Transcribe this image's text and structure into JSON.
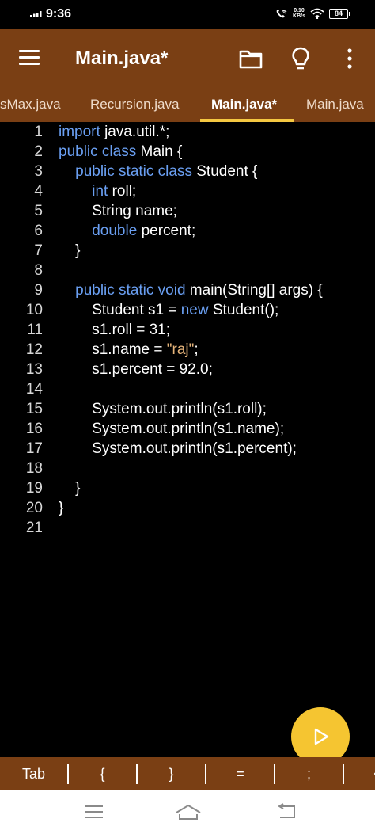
{
  "status": {
    "time": "9:36",
    "net_speed_value": "0.10",
    "net_speed_unit": "KB/s",
    "battery": "84"
  },
  "app_bar": {
    "title": "Main.java*",
    "icons": [
      "menu-icon",
      "folder-icon",
      "lightbulb-icon",
      "more-vert-icon"
    ]
  },
  "tabs": [
    {
      "label": "sMax.java"
    },
    {
      "label": "Recursion.java"
    },
    {
      "label": "Main.java*",
      "active": true
    },
    {
      "label": "Main.java"
    }
  ],
  "colors": {
    "app_bar": "#7a3f14",
    "keyword": "#6a9ff2",
    "string": "#e6b47a",
    "tab_indicator": "#f5c842",
    "fab": "#f5c531"
  },
  "editor": {
    "lines": [
      {
        "n": "1",
        "parts": [
          {
            "t": "import",
            "c": "kw"
          },
          {
            "t": " java.util.*;"
          }
        ]
      },
      {
        "n": "2",
        "parts": [
          {
            "t": "public class",
            "c": "kw"
          },
          {
            "t": " Main {"
          }
        ]
      },
      {
        "n": "3",
        "parts": [
          {
            "t": "    "
          },
          {
            "t": "public static class",
            "c": "kw"
          },
          {
            "t": " Student {"
          }
        ]
      },
      {
        "n": "4",
        "parts": [
          {
            "t": "        "
          },
          {
            "t": "int",
            "c": "kw"
          },
          {
            "t": " roll;"
          }
        ]
      },
      {
        "n": "5",
        "parts": [
          {
            "t": "        String name;"
          }
        ]
      },
      {
        "n": "6",
        "parts": [
          {
            "t": "        "
          },
          {
            "t": "double",
            "c": "kw"
          },
          {
            "t": " percent;"
          }
        ]
      },
      {
        "n": "7",
        "parts": [
          {
            "t": "    }"
          }
        ]
      },
      {
        "n": "8",
        "parts": []
      },
      {
        "n": "9",
        "parts": [
          {
            "t": "    "
          },
          {
            "t": "public static void",
            "c": "kw"
          },
          {
            "t": " main(String[] args) {"
          }
        ]
      },
      {
        "n": "10",
        "parts": [
          {
            "t": "        Student s1 = "
          },
          {
            "t": "new",
            "c": "kw"
          },
          {
            "t": " Student();"
          }
        ]
      },
      {
        "n": "11",
        "parts": [
          {
            "t": "        s1.roll = 31;"
          }
        ]
      },
      {
        "n": "12",
        "parts": [
          {
            "t": "        s1.name = "
          },
          {
            "t": "\"raj\"",
            "c": "str"
          },
          {
            "t": ";"
          }
        ]
      },
      {
        "n": "13",
        "parts": [
          {
            "t": "        s1.percent = 92.0;"
          }
        ]
      },
      {
        "n": "14",
        "parts": []
      },
      {
        "n": "15",
        "parts": [
          {
            "t": "        System.out.println(s1.roll);"
          }
        ]
      },
      {
        "n": "16",
        "parts": [
          {
            "t": "        System.out.println(s1.name);"
          }
        ]
      },
      {
        "n": "17",
        "parts": [
          {
            "t": "        System.out.println(s1.perce"
          },
          {
            "t": "",
            "c": "caret"
          },
          {
            "t": "nt);"
          }
        ]
      },
      {
        "n": "18",
        "parts": []
      },
      {
        "n": "19",
        "parts": [
          {
            "t": "    }"
          }
        ]
      },
      {
        "n": "20",
        "parts": [
          {
            "t": "}"
          }
        ]
      },
      {
        "n": "21",
        "parts": []
      }
    ]
  },
  "run_button": {
    "icon": "play-icon"
  },
  "symbol_bar": {
    "keys": [
      "Tab",
      "{",
      "}",
      "=",
      ";",
      "<"
    ]
  },
  "nav_bar": {
    "icons": [
      "recents-icon",
      "home-icon",
      "back-icon"
    ]
  }
}
